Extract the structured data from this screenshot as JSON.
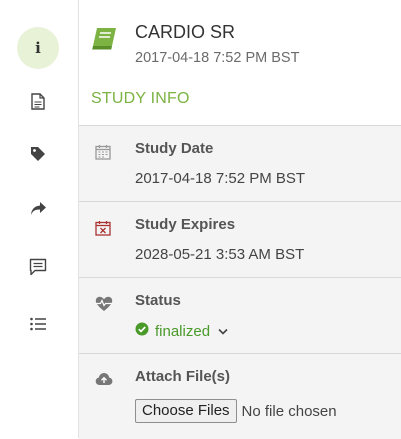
{
  "header": {
    "icon": "book-icon",
    "title": "CARDIO SR",
    "date": "2017-04-18 7:52 PM BST",
    "section": "STUDY INFO"
  },
  "rail": [
    {
      "icon": "info-icon",
      "glyph": "i",
      "active": true
    },
    {
      "icon": "document-icon",
      "active": false
    },
    {
      "icon": "tag-icon",
      "active": false
    },
    {
      "icon": "share-arrow-icon",
      "active": false
    },
    {
      "icon": "comment-icon",
      "active": false
    },
    {
      "icon": "list-icon",
      "active": false
    }
  ],
  "study_date": {
    "label": "Study Date",
    "value": "2017-04-18 7:52 PM BST",
    "icon": "calendar-icon"
  },
  "study_expires": {
    "label": "Study Expires",
    "value": "2028-05-21 3:53 AM BST",
    "icon": "calendar-x-icon"
  },
  "status": {
    "label": "Status",
    "value": "finalized",
    "icon": "heartbeat-icon"
  },
  "attach": {
    "label": "Attach File(s)",
    "button": "Choose Files",
    "no_file": "No file chosen",
    "icon": "cloud-upload-icon"
  },
  "colors": {
    "accent": "#7cb342",
    "status_green": "#4a9a2a",
    "expires_red": "#a33"
  }
}
